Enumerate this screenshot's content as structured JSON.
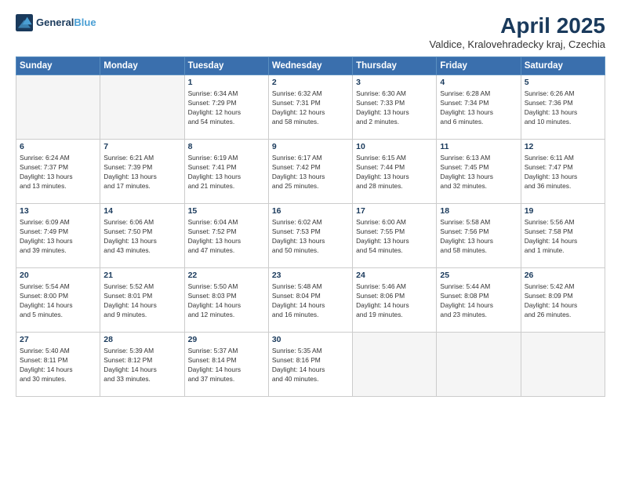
{
  "header": {
    "logo_line1": "General",
    "logo_line2": "Blue",
    "month": "April 2025",
    "location": "Valdice, Kralovehradecky kraj, Czechia"
  },
  "weekdays": [
    "Sunday",
    "Monday",
    "Tuesday",
    "Wednesday",
    "Thursday",
    "Friday",
    "Saturday"
  ],
  "weeks": [
    [
      {
        "day": "",
        "text": ""
      },
      {
        "day": "",
        "text": ""
      },
      {
        "day": "1",
        "text": "Sunrise: 6:34 AM\nSunset: 7:29 PM\nDaylight: 12 hours\nand 54 minutes."
      },
      {
        "day": "2",
        "text": "Sunrise: 6:32 AM\nSunset: 7:31 PM\nDaylight: 12 hours\nand 58 minutes."
      },
      {
        "day": "3",
        "text": "Sunrise: 6:30 AM\nSunset: 7:33 PM\nDaylight: 13 hours\nand 2 minutes."
      },
      {
        "day": "4",
        "text": "Sunrise: 6:28 AM\nSunset: 7:34 PM\nDaylight: 13 hours\nand 6 minutes."
      },
      {
        "day": "5",
        "text": "Sunrise: 6:26 AM\nSunset: 7:36 PM\nDaylight: 13 hours\nand 10 minutes."
      }
    ],
    [
      {
        "day": "6",
        "text": "Sunrise: 6:24 AM\nSunset: 7:37 PM\nDaylight: 13 hours\nand 13 minutes."
      },
      {
        "day": "7",
        "text": "Sunrise: 6:21 AM\nSunset: 7:39 PM\nDaylight: 13 hours\nand 17 minutes."
      },
      {
        "day": "8",
        "text": "Sunrise: 6:19 AM\nSunset: 7:41 PM\nDaylight: 13 hours\nand 21 minutes."
      },
      {
        "day": "9",
        "text": "Sunrise: 6:17 AM\nSunset: 7:42 PM\nDaylight: 13 hours\nand 25 minutes."
      },
      {
        "day": "10",
        "text": "Sunrise: 6:15 AM\nSunset: 7:44 PM\nDaylight: 13 hours\nand 28 minutes."
      },
      {
        "day": "11",
        "text": "Sunrise: 6:13 AM\nSunset: 7:45 PM\nDaylight: 13 hours\nand 32 minutes."
      },
      {
        "day": "12",
        "text": "Sunrise: 6:11 AM\nSunset: 7:47 PM\nDaylight: 13 hours\nand 36 minutes."
      }
    ],
    [
      {
        "day": "13",
        "text": "Sunrise: 6:09 AM\nSunset: 7:49 PM\nDaylight: 13 hours\nand 39 minutes."
      },
      {
        "day": "14",
        "text": "Sunrise: 6:06 AM\nSunset: 7:50 PM\nDaylight: 13 hours\nand 43 minutes."
      },
      {
        "day": "15",
        "text": "Sunrise: 6:04 AM\nSunset: 7:52 PM\nDaylight: 13 hours\nand 47 minutes."
      },
      {
        "day": "16",
        "text": "Sunrise: 6:02 AM\nSunset: 7:53 PM\nDaylight: 13 hours\nand 50 minutes."
      },
      {
        "day": "17",
        "text": "Sunrise: 6:00 AM\nSunset: 7:55 PM\nDaylight: 13 hours\nand 54 minutes."
      },
      {
        "day": "18",
        "text": "Sunrise: 5:58 AM\nSunset: 7:56 PM\nDaylight: 13 hours\nand 58 minutes."
      },
      {
        "day": "19",
        "text": "Sunrise: 5:56 AM\nSunset: 7:58 PM\nDaylight: 14 hours\nand 1 minute."
      }
    ],
    [
      {
        "day": "20",
        "text": "Sunrise: 5:54 AM\nSunset: 8:00 PM\nDaylight: 14 hours\nand 5 minutes."
      },
      {
        "day": "21",
        "text": "Sunrise: 5:52 AM\nSunset: 8:01 PM\nDaylight: 14 hours\nand 9 minutes."
      },
      {
        "day": "22",
        "text": "Sunrise: 5:50 AM\nSunset: 8:03 PM\nDaylight: 14 hours\nand 12 minutes."
      },
      {
        "day": "23",
        "text": "Sunrise: 5:48 AM\nSunset: 8:04 PM\nDaylight: 14 hours\nand 16 minutes."
      },
      {
        "day": "24",
        "text": "Sunrise: 5:46 AM\nSunset: 8:06 PM\nDaylight: 14 hours\nand 19 minutes."
      },
      {
        "day": "25",
        "text": "Sunrise: 5:44 AM\nSunset: 8:08 PM\nDaylight: 14 hours\nand 23 minutes."
      },
      {
        "day": "26",
        "text": "Sunrise: 5:42 AM\nSunset: 8:09 PM\nDaylight: 14 hours\nand 26 minutes."
      }
    ],
    [
      {
        "day": "27",
        "text": "Sunrise: 5:40 AM\nSunset: 8:11 PM\nDaylight: 14 hours\nand 30 minutes."
      },
      {
        "day": "28",
        "text": "Sunrise: 5:39 AM\nSunset: 8:12 PM\nDaylight: 14 hours\nand 33 minutes."
      },
      {
        "day": "29",
        "text": "Sunrise: 5:37 AM\nSunset: 8:14 PM\nDaylight: 14 hours\nand 37 minutes."
      },
      {
        "day": "30",
        "text": "Sunrise: 5:35 AM\nSunset: 8:16 PM\nDaylight: 14 hours\nand 40 minutes."
      },
      {
        "day": "",
        "text": ""
      },
      {
        "day": "",
        "text": ""
      },
      {
        "day": "",
        "text": ""
      }
    ]
  ]
}
